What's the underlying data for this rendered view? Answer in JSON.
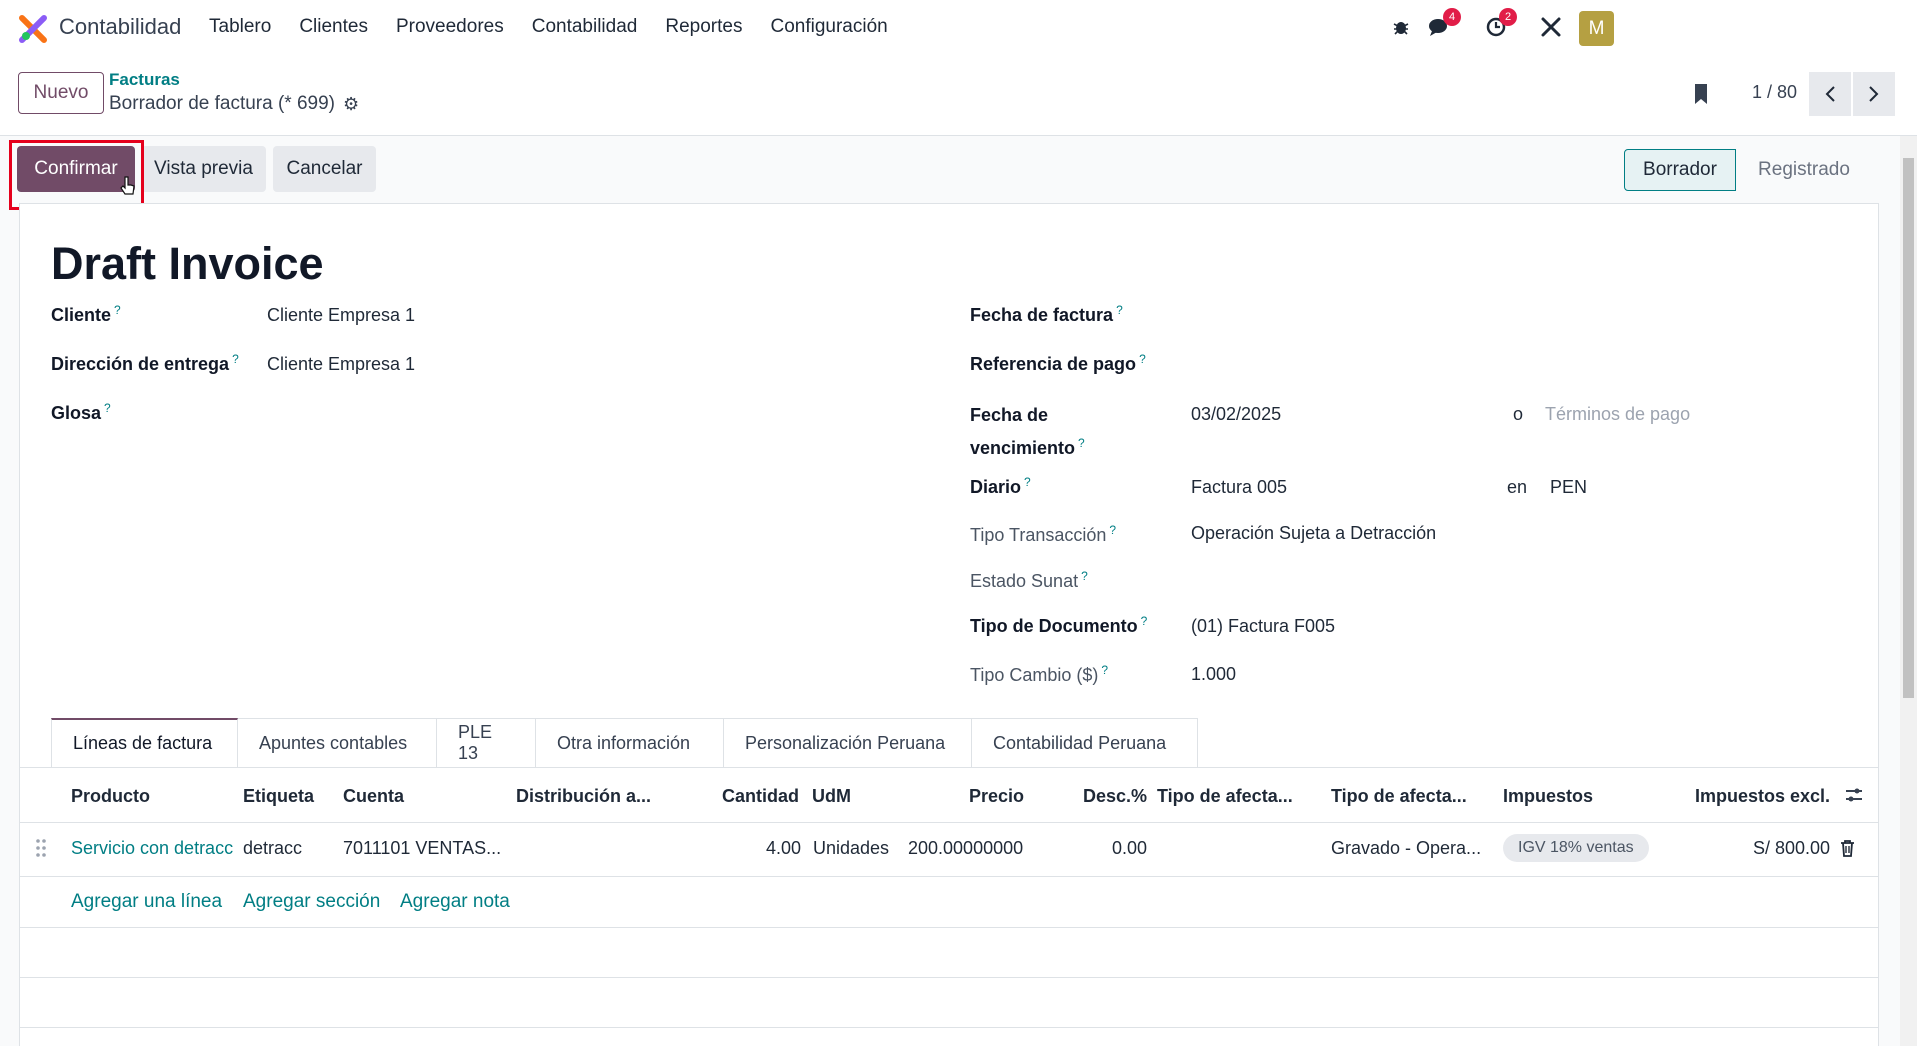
{
  "app": {
    "name": "Contabilidad"
  },
  "nav": [
    "Tablero",
    "Clientes",
    "Proveedores",
    "Contabilidad",
    "Reportes",
    "Configuración"
  ],
  "systray": {
    "messages_count": "4",
    "activities_count": "2",
    "avatar_letter": "M"
  },
  "control": {
    "new_label": "Nuevo",
    "breadcrumb_parent": "Facturas",
    "breadcrumb_current": "Borrador de factura (* 699)",
    "pager": "1 / 80"
  },
  "actions": {
    "confirm": "Confirmar",
    "preview": "Vista previa",
    "cancel": "Cancelar"
  },
  "status": {
    "draft": "Borrador",
    "posted": "Registrado"
  },
  "form": {
    "title": "Draft Invoice",
    "cliente_label": "Cliente",
    "cliente_value": "Cliente Empresa 1",
    "direccion_label": "Dirección de entrega",
    "direccion_value": "Cliente Empresa 1",
    "glosa_label": "Glosa",
    "fecha_factura_label": "Fecha de factura",
    "referencia_label": "Referencia de pago",
    "vencimiento_label_1": "Fecha de",
    "vencimiento_label_2": "vencimiento",
    "vencimiento_value": "03/02/2025",
    "o_text": "o",
    "terminos_placeholder": "Términos de pago",
    "diario_label": "Diario",
    "diario_value": "Factura 005",
    "en_text": "en",
    "moneda_value": "PEN",
    "tipo_transaccion_label": "Tipo Transacción",
    "tipo_transaccion_value": "Operación Sujeta a Detracción",
    "estado_sunat_label": "Estado Sunat",
    "tipo_documento_label": "Tipo de Documento",
    "tipo_documento_value": "(01) Factura F005",
    "tipo_cambio_label": "Tipo Cambio ($)",
    "tipo_cambio_value": "1.000",
    "help_mark": "?"
  },
  "tabs": [
    "Líneas de factura",
    "Apuntes contables",
    "PLE 13",
    "Otra información",
    "Personalización Peruana",
    "Contabilidad Peruana"
  ],
  "table": {
    "headers": {
      "producto": "Producto",
      "etiqueta": "Etiqueta",
      "cuenta": "Cuenta",
      "distribucion": "Distribución a...",
      "cantidad": "Cantidad",
      "udm": "UdM",
      "precio": "Precio",
      "desc": "Desc.%",
      "tipo_afecta_1": "Tipo de afecta...",
      "tipo_afecta_2": "Tipo de afecta...",
      "impuestos": "Impuestos",
      "impuestos_excl": "Impuestos excl."
    },
    "row": {
      "producto": "Servicio con detracc",
      "etiqueta": "detracc",
      "cuenta": "7011101 VENTAS...",
      "cantidad": "4.00",
      "udm": "Unidades",
      "precio": "200.00000000",
      "desc": "0.00",
      "tipo_afecta_2": "Gravado - Opera...",
      "impuesto_tag": "IGV 18% ventas",
      "subtotal": "S/ 800.00"
    },
    "add_line": "Agregar una línea",
    "add_section": "Agregar sección",
    "add_note": "Agregar nota"
  }
}
